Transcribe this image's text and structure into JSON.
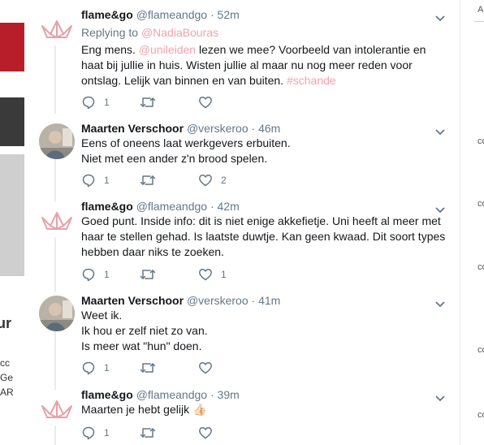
{
  "background": {
    "right_items": [
      "Ab",
      "co",
      "co",
      "co",
      "co",
      "co"
    ],
    "left_fragments": [
      "ur",
      "cc",
      "Ge",
      "AR"
    ]
  },
  "tweets": [
    {
      "name": "flame&go",
      "handle": "@flameandgo",
      "time": "52m",
      "replying_prefix": "Replying to",
      "replying_to": "@NadiaBouras",
      "text": [
        {
          "t": "Eng mens. "
        },
        {
          "t": "@unileiden",
          "link": true
        },
        {
          "t": " lezen we mee? Voorbeeld van intolerantie en haat bij jullie in huis. Wisten jullie al maar nu nog meer reden voor ontslag. Lelijk van binnen en van buiten. "
        },
        {
          "t": "#schande",
          "link": true
        }
      ],
      "reply_count": "1",
      "retweet_count": "",
      "like_count": "",
      "avatar": "flame-logo"
    },
    {
      "name": "Maarten Verschoor",
      "handle": "@verskeroo",
      "time": "46m",
      "lines": [
        "Eens of oneens laat werkgevers erbuiten.",
        "Niet met een ander z'n brood spelen."
      ],
      "reply_count": "1",
      "retweet_count": "",
      "like_count": "2",
      "avatar": "photo"
    },
    {
      "name": "flame&go",
      "handle": "@flameandgo",
      "time": "42m",
      "lines": [
        "Goed punt. Inside info: dit is niet enige akkefietje. Uni heeft al meer met haar te stellen gehad. Is laatste duwtje. Kan geen kwaad. Dit soort types hebben daar niks te zoeken."
      ],
      "reply_count": "1",
      "retweet_count": "",
      "like_count": "1",
      "avatar": "flame-logo"
    },
    {
      "name": "Maarten Verschoor",
      "handle": "@verskeroo",
      "time": "41m",
      "lines": [
        "Weet ik.",
        "Ik hou er zelf niet zo van.",
        "Is meer wat \"hun\" doen."
      ],
      "reply_count": "1",
      "retweet_count": "",
      "like_count": "",
      "avatar": "photo"
    },
    {
      "name": "flame&go",
      "handle": "@flameandgo",
      "time": "39m",
      "lines": [
        "Maarten je hebt gelijk 👍🏻"
      ],
      "reply_count": "1",
      "retweet_count": "",
      "like_count": "",
      "avatar": "flame-logo"
    }
  ],
  "colors": {
    "name": "#14171a",
    "secondary": "#657786",
    "link": "#f0a3ac",
    "thread_line": "#e6ecf0",
    "logo": "#e8a0a8"
  }
}
